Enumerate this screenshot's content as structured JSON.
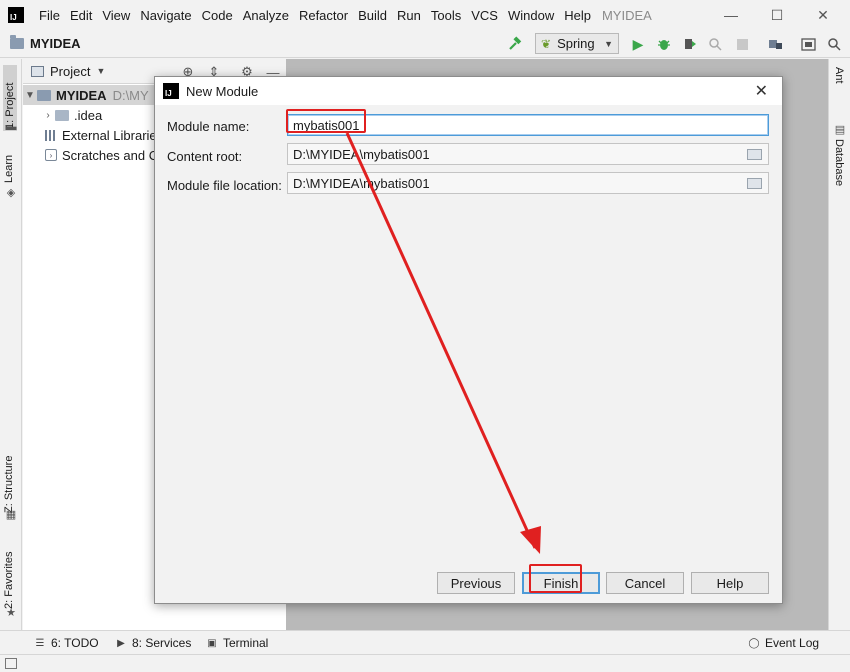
{
  "app": {
    "logo": "IJ",
    "project_title": "MYIDEA"
  },
  "menu": {
    "items": [
      "File",
      "Edit",
      "View",
      "Navigate",
      "Code",
      "Analyze",
      "Refactor",
      "Build",
      "Run",
      "Tools",
      "VCS",
      "Window",
      "Help"
    ],
    "window_title": "MYIDEA"
  },
  "window_controls": {
    "minimize": "—",
    "maximize": "☐",
    "close": "✕"
  },
  "toolbar": {
    "run_config": "Spring",
    "icons": [
      "hammer-icon",
      "run-icon",
      "debug-icon",
      "coverage-icon",
      "profile-icon",
      "stop-icon",
      "project-structure-icon",
      "terminal-frame-icon",
      "search-everywhere-icon"
    ]
  },
  "left_stripe": {
    "project_tab": "1: Project",
    "learn_tab": "Learn",
    "structure_tab": "Z: Structure",
    "favorites_tab": "2: Favorites"
  },
  "right_stripe": {
    "ant_tab": "Ant",
    "database_tab": "Database"
  },
  "project_panel": {
    "header_label": "Project",
    "tree": [
      {
        "label": "MYIDEA",
        "path": "D:\\MY",
        "selected": true
      },
      {
        "label": ".idea"
      },
      {
        "label": "External Librarie"
      },
      {
        "label": "Scratches and C"
      }
    ]
  },
  "dialog": {
    "logo": "IJ",
    "title": "New Module",
    "fields": {
      "module_name_label": "Module name:",
      "module_name_value": "mybatis001",
      "content_root_label": "Content root:",
      "content_root_value": "D:\\MYIDEA\\mybatis001",
      "module_file_label": "Module file location:",
      "module_file_value": "D:\\MYIDEA\\mybatis001"
    },
    "buttons": {
      "previous": "Previous",
      "finish": "Finish",
      "cancel": "Cancel",
      "help": "Help"
    }
  },
  "bottom_tabs": {
    "todo": "6: TODO",
    "services": "8: Services",
    "terminal": "Terminal",
    "event_log": "Event Log"
  },
  "colors": {
    "annotation_red": "#e02020",
    "focus_blue": "#4d9bd8",
    "run_green": "#3aa74a"
  }
}
